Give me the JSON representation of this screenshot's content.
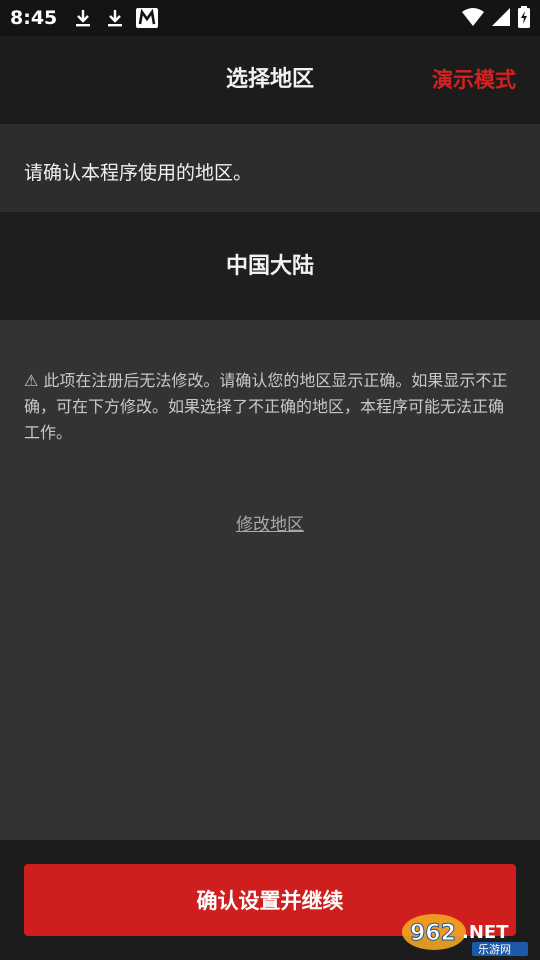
{
  "status_bar": {
    "time": "8:45",
    "left_icons": [
      "download-icon",
      "download-icon",
      "m-app-icon"
    ],
    "right_icons": [
      "wifi-icon",
      "signal-icon",
      "battery-icon"
    ]
  },
  "header": {
    "title": "选择地区",
    "demo_mode_label": "演示模式"
  },
  "notice": {
    "text": "请确认本程序使用的地区。"
  },
  "region": {
    "name": "中国大陆"
  },
  "warning": {
    "icon": "warning-triangle-icon",
    "text": "⚠ 此项在注册后无法修改。请确认您的地区显示正确。如果显示不正确，可在下方修改。如果选择了不正确的地区，本程序可能无法正确工作。"
  },
  "change_region_label": "修改地区",
  "confirm_button_label": "确认设置并继续",
  "watermark": {
    "brand": "962.NET",
    "sub": "乐游网"
  },
  "colors": {
    "accent_red": "#cf1e1e",
    "demo_red": "#d32222",
    "background": "#333333"
  }
}
